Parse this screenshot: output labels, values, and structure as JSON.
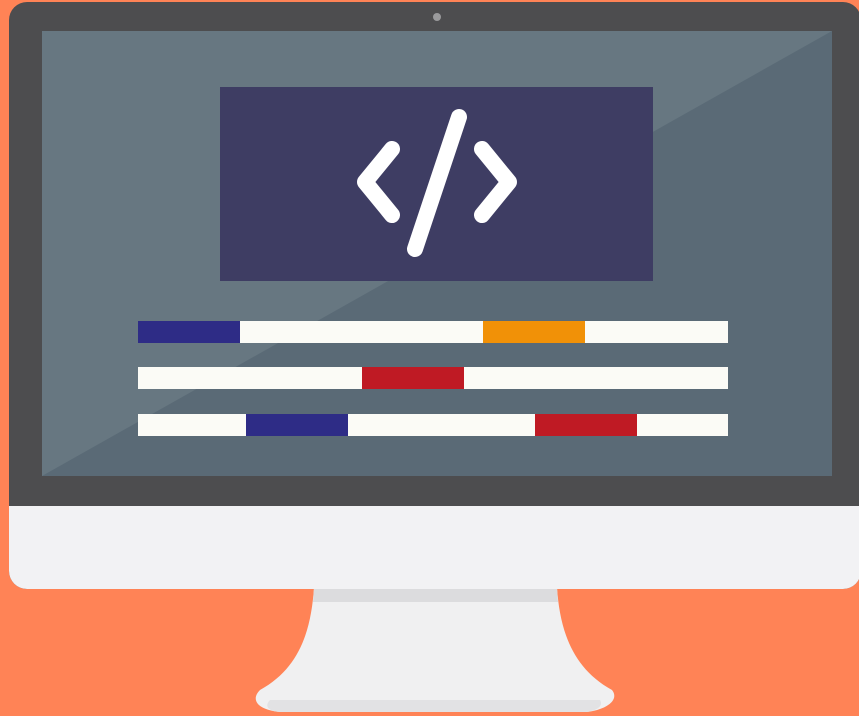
{
  "colors": {
    "background": "#ff8356",
    "bezel": "#4d4d4f",
    "chin": "#f2f2f4",
    "screen": "#5a6a76",
    "code_panel": "#3e3d63",
    "code_symbol": "#ffffff",
    "line": "#fbfbf6",
    "blue": "#2e2c86",
    "orange": "#f19107",
    "red": "#bf1a24"
  },
  "icon": "code-brackets-icon",
  "code_lines": [
    {
      "segments": [
        {
          "color": "blue"
        },
        {
          "color": "orange"
        }
      ]
    },
    {
      "segments": [
        {
          "color": "red"
        }
      ]
    },
    {
      "segments": [
        {
          "color": "blue"
        },
        {
          "color": "red"
        }
      ]
    }
  ]
}
